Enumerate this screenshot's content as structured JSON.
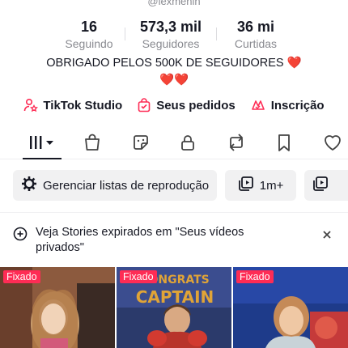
{
  "profile": {
    "handle": "@lexmenin",
    "stats": [
      {
        "value": "16",
        "label": "Seguindo"
      },
      {
        "value": "573,3 mil",
        "label": "Seguidores"
      },
      {
        "value": "36 mi",
        "label": "Curtidas"
      }
    ],
    "bio_line1": "OBRIGADO PELOS 500K DE SEGUIDORES",
    "bio_heart1": "❤️",
    "bio_line2": "❤️❤️"
  },
  "links": [
    {
      "label": "TikTok Studio",
      "icon": "person-star-icon"
    },
    {
      "label": "Seus pedidos",
      "icon": "order-bag-icon"
    },
    {
      "label": "Inscrição",
      "icon": "subscription-badge-icon"
    }
  ],
  "tabs": [
    {
      "name": "videos-grid-icon",
      "active": true
    },
    {
      "name": "shop-bag-icon"
    },
    {
      "name": "sticker-icon"
    },
    {
      "name": "lock-icon"
    },
    {
      "name": "repost-icon"
    },
    {
      "name": "bookmark-icon"
    },
    {
      "name": "heart-outline-icon"
    }
  ],
  "chips": [
    {
      "label": "Gerenciar listas de reprodução",
      "icon": "gear-icon"
    },
    {
      "label": "1m+",
      "icon": "playlist-video-icon"
    },
    {
      "label": "",
      "icon": "playlist-video-icon"
    }
  ],
  "banner": {
    "text": "Veja Stories expirados em \"Seus vídeos privados\"",
    "icon": "add-circle-icon",
    "close_icon": "close-icon"
  },
  "videos": [
    {
      "badge": "Fixado"
    },
    {
      "badge": "Fixado"
    },
    {
      "badge": "Fixado"
    }
  ],
  "colors": {
    "accent": "#fe2c55",
    "text": "#161823",
    "muted": "#8a8b91"
  }
}
